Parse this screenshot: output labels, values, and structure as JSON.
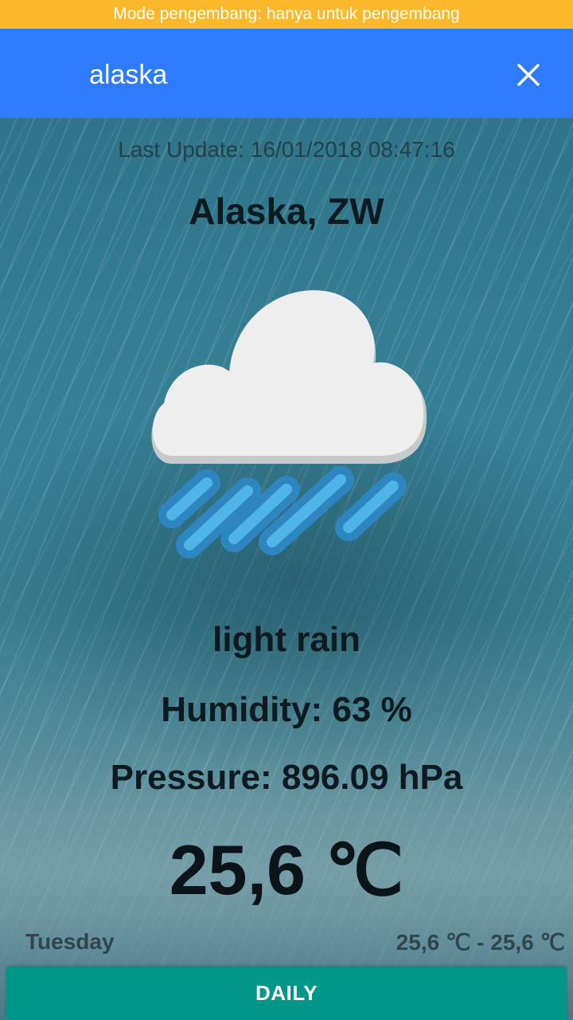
{
  "dev_banner": "Mode pengembang: hanya untuk pengembang",
  "search": {
    "value": "alaska",
    "close_icon": "close-icon"
  },
  "weather": {
    "last_update": "Last Update: 16/01/2018 08:47:16",
    "city": "Alaska, ZW",
    "icon": "cloud-rain-icon",
    "description": "light rain",
    "humidity": "Humidity: 63 %",
    "pressure": "Pressure: 896.09 hPa",
    "temperature": "25,6 ℃"
  },
  "forecast": {
    "day": "Tuesday",
    "temps": "25,6 ℃ - 25,6 ℃"
  },
  "daily_button": "DAILY",
  "colors": {
    "banner": "#FBB82A",
    "app_bar": "#2F7BFF",
    "daily_button": "#009688"
  }
}
